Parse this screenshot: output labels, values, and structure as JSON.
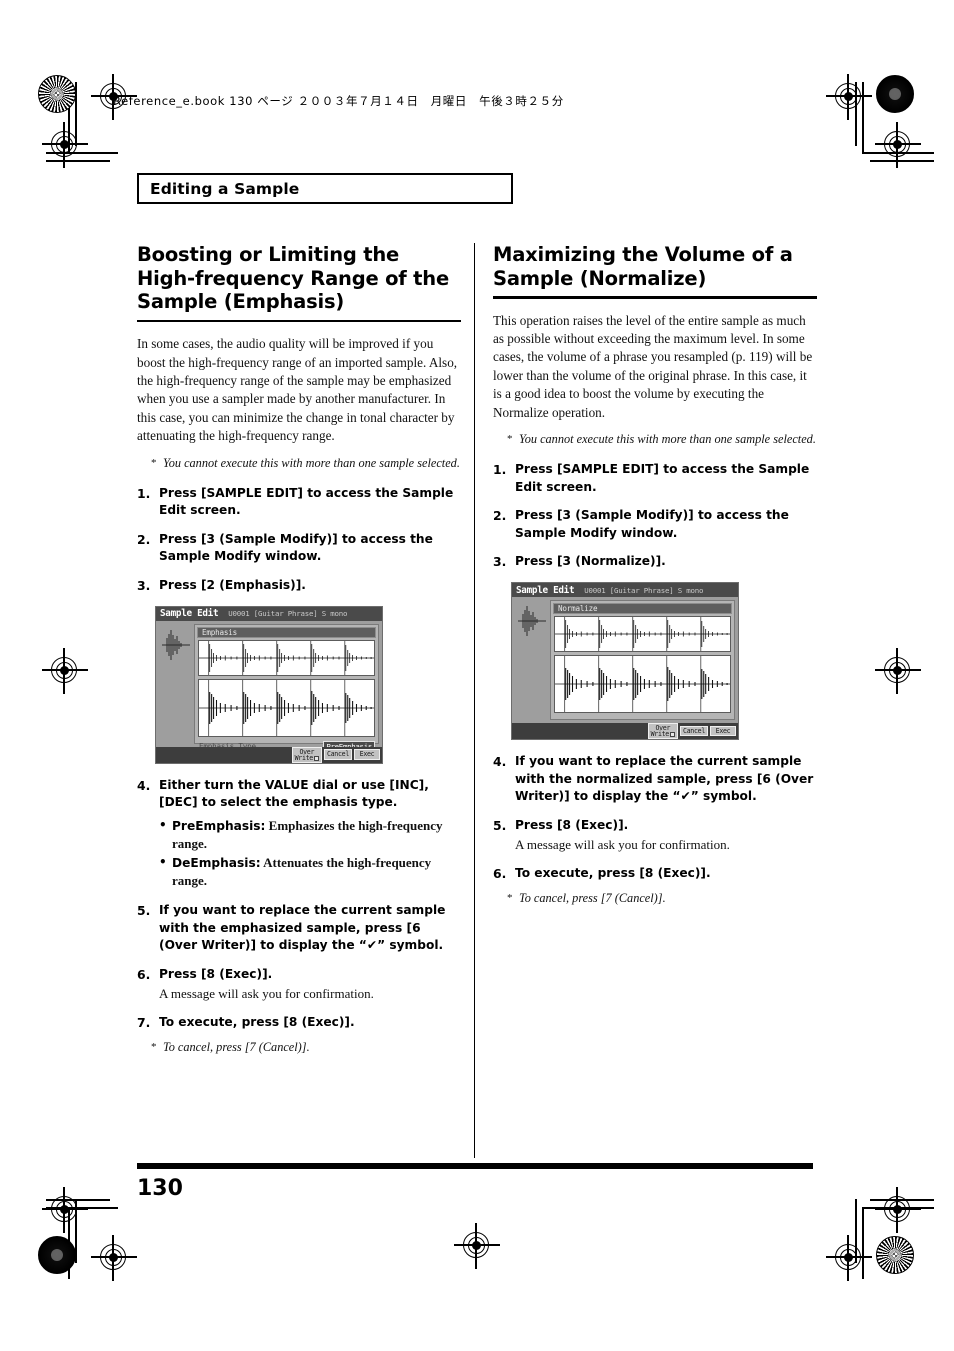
{
  "meta": {
    "filestamp": "Reference_e.book  130 ページ  ２００３年７月１４日　月曜日　午後３時２５分",
    "page_number": "130"
  },
  "section_header": {
    "label": "Editing a Sample"
  },
  "columns": {
    "left": {
      "title": "Boosting or Limiting the High-frequency Range of the Sample (Emphasis)",
      "intro": "In some cases, the audio quality will be improved if you boost the high-frequency range of an imported sample. Also, the high-frequency range of the sample may be emphasized when you use a sampler made by another manufacturer. In this case, you can minimize the change in tonal character by attenuating the high-frequency range.",
      "intro_note": "You cannot execute this with more than one sample selected.",
      "steps_before": [
        {
          "num": "1.",
          "text": "Press [SAMPLE EDIT] to access the Sample Edit screen."
        },
        {
          "num": "2.",
          "text": "Press [3 (Sample Modify)] to access the Sample Modify window."
        },
        {
          "num": "3.",
          "text": "Press [2 (Emphasis)]."
        }
      ],
      "step4": {
        "num": "4.",
        "text": "Either turn the VALUE dial or use [INC], [DEC] to select the emphasis type."
      },
      "bullets": [
        {
          "term": "PreEmphasis:",
          "desc": "Emphasizes the high-frequency range."
        },
        {
          "term": "DeEmphasis:",
          "desc": "Attenuates the high-frequency range."
        }
      ],
      "step5": {
        "num": "5.",
        "text_a": "If you want to replace the current sample with the emphasized sample, press [6 (Over Writer)] to display the “",
        "check": "✔",
        "text_b": "” symbol."
      },
      "step6": {
        "num": "6.",
        "text": "Press [8 (Exec)].",
        "sub": "A message will ask you for confirmation."
      },
      "step7": {
        "num": "7.",
        "text": "To execute, press [8 (Exec)]."
      },
      "end_note": "To cancel, press [7 (Cancel)].",
      "lcd": {
        "title": "Sample Edit",
        "subtitle": "U0001 [Guitar Phrase]  S mono",
        "window_title": "Emphasis",
        "param_label": "Emphasis Type",
        "param_value": "PreEmphasis",
        "buttons": [
          {
            "line1": "Over",
            "line2": "Write",
            "has_check": true
          },
          {
            "line1": "Cancel",
            "line2": "",
            "has_check": false
          },
          {
            "line1": "Exec",
            "line2": "",
            "has_check": false
          }
        ]
      }
    },
    "right": {
      "title": "Maximizing the Volume of a Sample (Normalize)",
      "intro": "This operation raises the level of the entire sample as much as possible without exceeding the maximum level. In some cases, the volume of a phrase you resampled (p. 119) will be lower than the volume of the original phrase. In this case, it is a good idea to boost the volume by executing the Normalize operation.",
      "intro_note": "You cannot execute this with more than one sample selected.",
      "steps_before": [
        {
          "num": "1.",
          "text": "Press [SAMPLE EDIT] to access the Sample Edit screen."
        },
        {
          "num": "2.",
          "text": "Press [3 (Sample Modify)] to access the Sample Modify window."
        },
        {
          "num": "3.",
          "text": "Press [3 (Normalize)]."
        }
      ],
      "step4": {
        "num": "4.",
        "text_a": "If you want to replace the current sample with the normalized sample, press [6 (Over Writer)] to display the “",
        "check": "✔",
        "text_b": "” symbol."
      },
      "step5": {
        "num": "5.",
        "text": "Press [8 (Exec)].",
        "sub": "A message will ask you for confirmation."
      },
      "step6": {
        "num": "6.",
        "text": "To execute, press [8 (Exec)]."
      },
      "end_note": "To cancel, press [7 (Cancel)].",
      "lcd": {
        "title": "Sample Edit",
        "subtitle": "U0001 [Guitar Phrase]  S mono",
        "window_title": "Normalize",
        "buttons": [
          {
            "line1": "Over",
            "line2": "Write",
            "has_check": true
          },
          {
            "line1": "Cancel",
            "line2": "",
            "has_check": false
          },
          {
            "line1": "Exec",
            "line2": "",
            "has_check": false
          }
        ]
      }
    }
  },
  "colors": {
    "ink": "#000000",
    "paper": "#ffffff",
    "lcd_bg": "#9e9e9e",
    "lcd_titlebar": "#4a4a4a",
    "lcd_window": "#b5b5b5",
    "lcd_wave_bg": "#ffffff"
  }
}
